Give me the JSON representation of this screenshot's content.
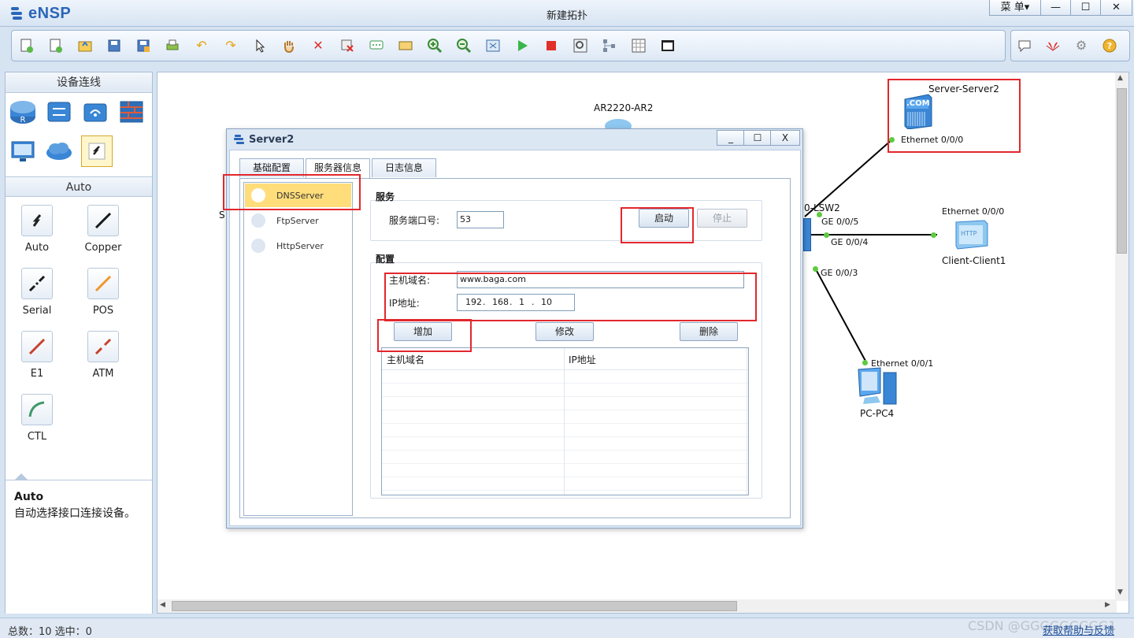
{
  "app": {
    "name": "eNSP",
    "window_title": "新建拓扑",
    "menu_label": "菜 单▾",
    "controls": {
      "minimize": "—",
      "maximize": "☐",
      "close": "✕"
    }
  },
  "toolbar_icons": [
    "new-topology",
    "new-example",
    "open",
    "save",
    "save-as",
    "print",
    "undo",
    "redo",
    "select",
    "pan",
    "delete",
    "delete-link",
    "text-annotation",
    "rectangle",
    "zoom-in",
    "zoom-out",
    "fit-view",
    "start",
    "stop",
    "capture",
    "topology-tree",
    "grid",
    "console"
  ],
  "toolbar_right_icons": [
    "chat",
    "huawei-logo",
    "settings",
    "help"
  ],
  "left_panel": {
    "section_title": "设备连线",
    "device_categories": [
      "router",
      "switch",
      "wireless",
      "firewall",
      "terminal",
      "cloud",
      "cable"
    ],
    "cable_section_title": "Auto",
    "cables": [
      {
        "label": "Auto",
        "color": "#333333"
      },
      {
        "label": "Copper",
        "color": "#1a1a1a"
      },
      {
        "label": "Serial",
        "color": "#1a1a1a"
      },
      {
        "label": "POS",
        "color": "#f0962d"
      },
      {
        "label": "E1",
        "color": "#c8412c"
      },
      {
        "label": "ATM",
        "color": "#c8412c"
      },
      {
        "label": "CTL",
        "color": "#3f9a6a"
      }
    ],
    "description": {
      "title": "Auto",
      "text": "自动选择接口连接设备。"
    }
  },
  "canvas": {
    "nodes": {
      "ar2220": "AR2220-AR2",
      "server": "Server-Server2",
      "client": "Client-Client1",
      "pc": "PC-PC4",
      "switch_partial": "0-LSW2",
      "partial_left": "S"
    },
    "ports": {
      "server_eth": "Ethernet 0/0/0",
      "client_eth": "Ethernet 0/0/0",
      "pc_eth": "Ethernet 0/0/1",
      "ge5": "GE 0/0/5",
      "ge4": "GE 0/0/4",
      "ge3": "GE 0/0/3"
    },
    "server_icon_text": ".COM",
    "client_icon_text": "HTTP"
  },
  "status": {
    "left": "总数：10 选中：0",
    "help_link": "获取帮助与反馈",
    "watermark": "CSDN @GGGGGGGGG1"
  },
  "dialog": {
    "title": "Server2",
    "controls": {
      "minimize": "_",
      "maximize": "☐",
      "close": "X"
    },
    "tabs": [
      "基础配置",
      "服务器信息",
      "日志信息"
    ],
    "active_tab": 1,
    "services": [
      "DNSServer",
      "FtpServer",
      "HttpServer"
    ],
    "active_service": 0,
    "service_group": {
      "title": "服务",
      "port_label": "服务端口号:",
      "port_value": "53",
      "start_button": "启动",
      "stop_button": "停止"
    },
    "config_group": {
      "title": "配置",
      "host_label": "主机域名:",
      "host_value": "www.baga.com",
      "ip_label": "IP地址:",
      "ip_octets": [
        "192",
        "168",
        "1",
        "10"
      ],
      "ip_separator": ".",
      "add_button": "增加",
      "modify_button": "修改",
      "delete_button": "删除",
      "table_columns": [
        "主机域名",
        "IP地址"
      ]
    }
  },
  "colors": {
    "highlight_red": "#e2272d",
    "active_service_bg": "#ffdd7a",
    "link_green": "#5dcb3e",
    "brand_blue": "#2a66b8"
  }
}
